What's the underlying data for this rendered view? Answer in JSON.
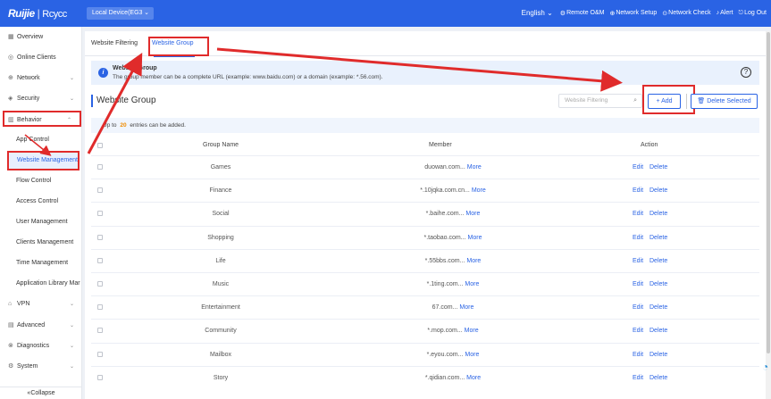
{
  "topbar": {
    "logo_brand": "Ruijie",
    "logo_sub": "Rcycc",
    "device_select": "Local Device(EG3",
    "language": "English",
    "nav": [
      {
        "icon": "remote-icon",
        "label": "Remote O&M"
      },
      {
        "icon": "network-icon",
        "label": "Network Setup"
      },
      {
        "icon": "check-icon",
        "label": "Network Check"
      },
      {
        "icon": "bell-icon",
        "label": "Alert"
      },
      {
        "icon": "logout-icon",
        "label": "Log Out"
      }
    ],
    "color": "#2a63e4"
  },
  "sidebar": {
    "items": [
      {
        "label": "Overview",
        "icon": "overview-icon"
      },
      {
        "label": "Online Clients",
        "icon": "clients-icon"
      },
      {
        "label": "Network",
        "icon": "globe-icon"
      },
      {
        "label": "Security",
        "icon": "shield-icon"
      },
      {
        "label": "Behavior",
        "icon": "chart-icon"
      },
      {
        "label": "App Control"
      },
      {
        "label": "Website Management"
      },
      {
        "label": "Flow Control"
      },
      {
        "label": "Access Control"
      },
      {
        "label": "User Management"
      },
      {
        "label": "Clients Management"
      },
      {
        "label": "Time Management"
      },
      {
        "label": "Application Library Mar"
      },
      {
        "label": "VPN",
        "icon": "vpn-icon"
      },
      {
        "label": "Advanced",
        "icon": "advanced-icon"
      },
      {
        "label": "Diagnostics",
        "icon": "diagnostics-icon"
      },
      {
        "label": "System",
        "icon": "gear-icon"
      }
    ],
    "collapse_label": "Collapse"
  },
  "tabs": {
    "website_filtering": "Website Filtering",
    "website_group": "Website Group"
  },
  "info": {
    "title": "Website Group",
    "desc": "The group member can be a complete URL (example: www.baidu.com) or a domain (example: *.56.com)."
  },
  "section": {
    "title": "Website Group",
    "search_placeholder": "Website Filtering",
    "add_label": "+ Add",
    "delete_label": "Delete Selected"
  },
  "limit": {
    "prefix": "Up to",
    "count": "20",
    "suffix": "entries can be added."
  },
  "table": {
    "headers": {
      "name": "Group Name",
      "member": "Member",
      "action": "Action"
    },
    "edit_label": "Edit",
    "delete_label": "Delete",
    "more_label": "More",
    "rows": [
      {
        "name": "Games",
        "member": "duowan.com..."
      },
      {
        "name": "Finance",
        "member": "*.10jqka.com.cn..."
      },
      {
        "name": "Social",
        "member": "*.baihe.com..."
      },
      {
        "name": "Shopping",
        "member": "*.taobao.com..."
      },
      {
        "name": "Life",
        "member": "*.55bbs.com..."
      },
      {
        "name": "Music",
        "member": "*.1ting.com..."
      },
      {
        "name": "Entertainment",
        "member": "67.com..."
      },
      {
        "name": "Community",
        "member": "*.mop.com..."
      },
      {
        "name": "Mailbox",
        "member": "*.eyou.com..."
      },
      {
        "name": "Story",
        "member": "*.qidian.com..."
      }
    ]
  },
  "annotation_color": "#e02b2b"
}
